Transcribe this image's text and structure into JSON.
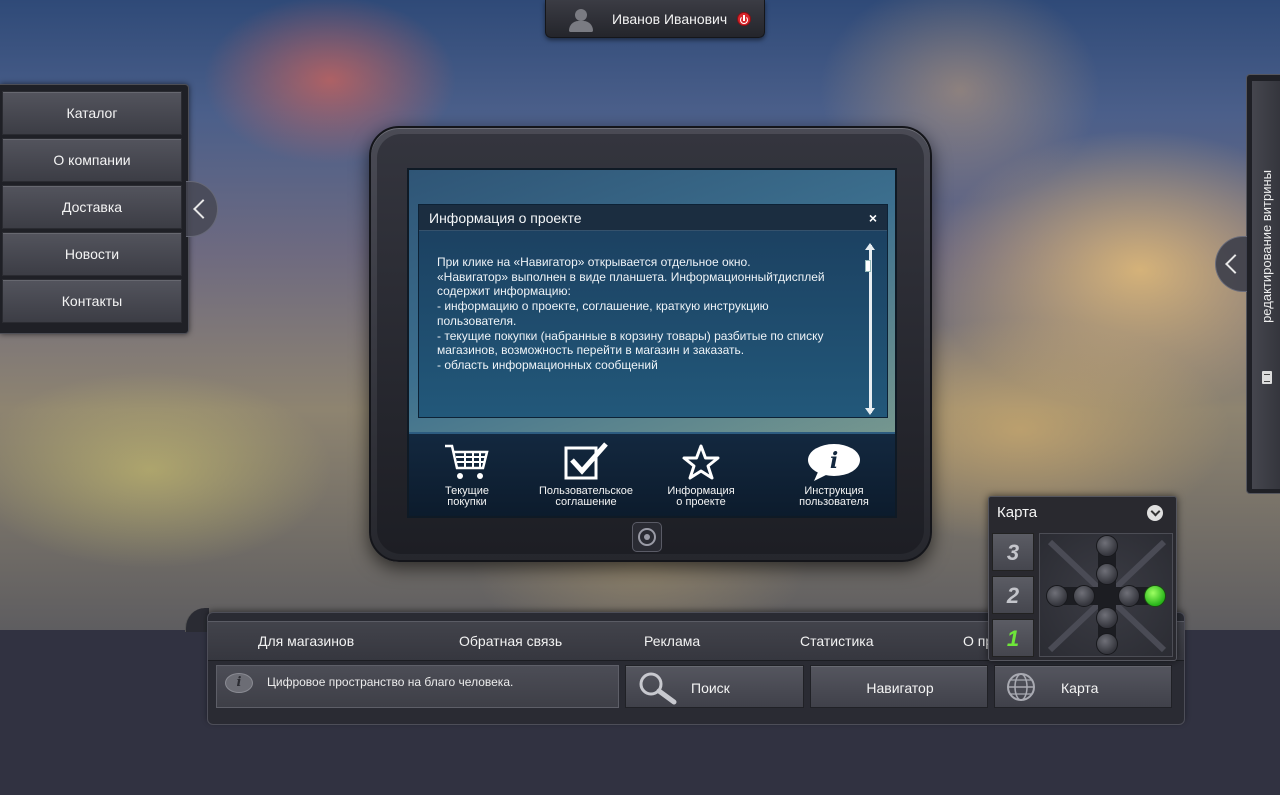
{
  "user": {
    "name": "Иванов Иванович"
  },
  "left_menu": {
    "items": [
      {
        "label": "Каталог"
      },
      {
        "label": "О компании"
      },
      {
        "label": "Доставка"
      },
      {
        "label": "Новости"
      },
      {
        "label": "Контакты"
      }
    ]
  },
  "right_panel": {
    "label": "редактирование витрины"
  },
  "info_window": {
    "title": "Информация о проекте",
    "close_label": "×",
    "lines": [
      "При клике на «Навигатор» открывается отдельное окно.",
      "«Навигатор» выполнен в виде планшета. Информационныйтдисплей",
      "содержит информацию:",
      "- информацию о проекте, соглашение, краткую инструкцию",
      "пользователя.",
      "- текущие покупки (набранные в корзину товары) разбитые по списку",
      "магазинов, возможность перейти в магазин и заказать.",
      "- область информационных сообщений"
    ]
  },
  "dock": {
    "items": [
      {
        "label1": "Текущие",
        "label2": "покупки",
        "icon": "cart-icon"
      },
      {
        "label1": "Пользовательское",
        "label2": "соглашение",
        "icon": "checkbox-icon"
      },
      {
        "label1": "Информация",
        "label2": "о проекте",
        "icon": "star-icon"
      },
      {
        "label1": "Инструкция",
        "label2": "пользователя",
        "icon": "info-bubble-icon"
      }
    ]
  },
  "bottom_nav": {
    "links": [
      {
        "label": "Для магазинов"
      },
      {
        "label": "Обратная связь"
      },
      {
        "label": "Реклама"
      },
      {
        "label": "Статистика"
      },
      {
        "label": "О пр"
      }
    ]
  },
  "message": {
    "text": "Цифровое пространство на благо человека."
  },
  "buttons": {
    "search": "Поиск",
    "navigator": "Навигатор",
    "map": "Карта"
  },
  "map_widget": {
    "title": "Карта",
    "floors": [
      "3",
      "2",
      "1"
    ],
    "active_floor": "1"
  }
}
